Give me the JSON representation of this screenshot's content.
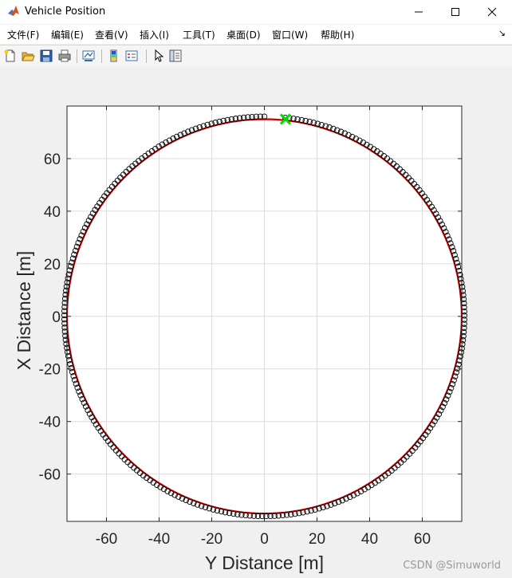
{
  "window": {
    "title": "Vehicle Position",
    "controls": [
      "minimize",
      "maximize",
      "close"
    ]
  },
  "menu": [
    "文件(F)",
    "编辑(E)",
    "查看(V)",
    "插入(I)",
    "工具(T)",
    "桌面(D)",
    "窗口(W)",
    "帮助(H)"
  ],
  "toolbar": [
    "new-figure-icon",
    "open-file-icon",
    "save-icon",
    "print-icon",
    "link-plot-icon",
    "colorbar-icon",
    "legend-icon",
    "pointer-icon",
    "property-editor-icon"
  ],
  "watermark": "CSDN @Simuworld",
  "chart_data": {
    "type": "scatter",
    "xlabel": "Y Distance [m]",
    "ylabel": "X Distance [m]",
    "xlim": [
      -75,
      75
    ],
    "ylim": [
      -78,
      80
    ],
    "xticks": [
      -60,
      -40,
      -20,
      0,
      20,
      40,
      60
    ],
    "yticks": [
      -60,
      -40,
      -20,
      0,
      20,
      40,
      60
    ],
    "grid": true,
    "series": [
      {
        "style": "reference path",
        "shape": "circle",
        "center": [
          0,
          0
        ],
        "radius": 75,
        "color": "#cc0000"
      },
      {
        "style": "vehicle position markers",
        "shape": "circle",
        "center": [
          0,
          0
        ],
        "radius": 76,
        "from_angle_deg": 84,
        "to_angle_deg": -270,
        "marker": "o",
        "color": "#000000"
      },
      {
        "style": "current position",
        "x": 8,
        "y": 75,
        "marker": "x",
        "color": "#00dd00"
      }
    ]
  }
}
